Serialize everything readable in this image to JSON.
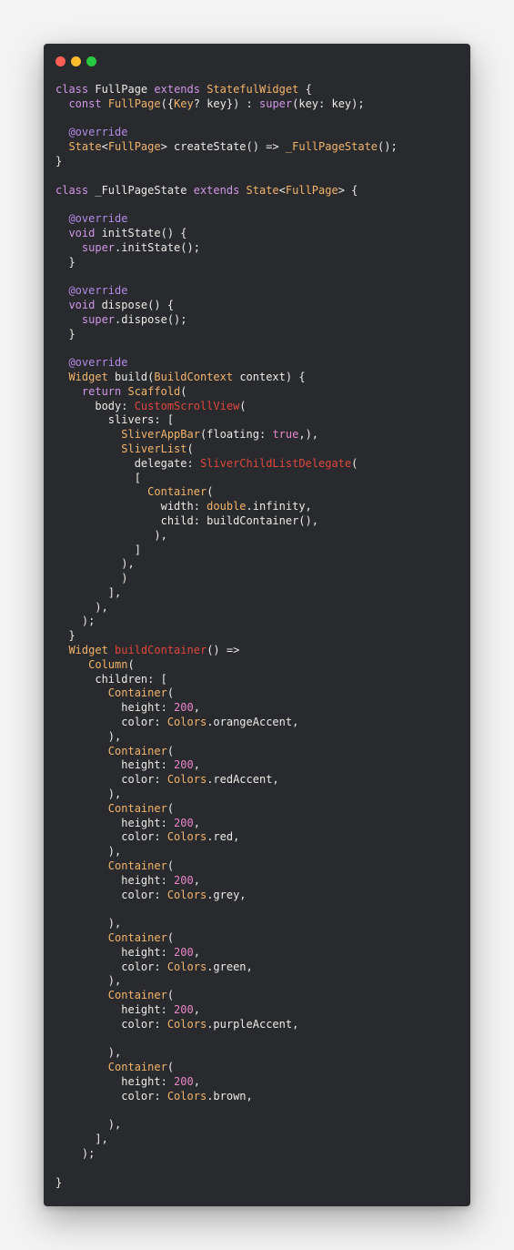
{
  "window": {
    "title_dots": [
      {
        "name": "close-dot",
        "color": "#fe5f57"
      },
      {
        "name": "minimize-dot",
        "color": "#febc2e"
      },
      {
        "name": "zoom-dot",
        "color": "#28c840"
      }
    ]
  },
  "colors": {
    "background": "#282a2e",
    "plain": "#ecebe4",
    "keyword": "#cf97e8",
    "type": "#f3b46b",
    "string": "#e0463e",
    "number": "#eb86c9",
    "decorator": "#b48ae7"
  },
  "code_lines": [
    [
      [
        "kw",
        "class "
      ],
      [
        "plain",
        "FullPage "
      ],
      [
        "kw",
        "extends "
      ],
      [
        "type",
        "StatefulWidget"
      ],
      [
        "plain",
        " {"
      ]
    ],
    [
      [
        "plain",
        "  "
      ],
      [
        "kw",
        "const "
      ],
      [
        "type",
        "FullPage"
      ],
      [
        "plain",
        "({"
      ],
      [
        "type",
        "Key"
      ],
      [
        "plain",
        "? key}) : "
      ],
      [
        "kw",
        "super"
      ],
      [
        "plain",
        "(key: key);"
      ]
    ],
    [],
    [
      [
        "plain",
        "  "
      ],
      [
        "deco",
        "@override"
      ]
    ],
    [
      [
        "plain",
        "  "
      ],
      [
        "type",
        "State"
      ],
      [
        "plain",
        "<"
      ],
      [
        "type",
        "FullPage"
      ],
      [
        "plain",
        "> createState() => "
      ],
      [
        "type",
        "_FullPageState"
      ],
      [
        "plain",
        "();"
      ]
    ],
    [
      [
        "plain",
        "}"
      ]
    ],
    [],
    [
      [
        "kw",
        "class "
      ],
      [
        "plain",
        "_FullPageState "
      ],
      [
        "kw",
        "extends "
      ],
      [
        "type",
        "State"
      ],
      [
        "plain",
        "<"
      ],
      [
        "type",
        "FullPage"
      ],
      [
        "plain",
        "> {"
      ]
    ],
    [],
    [
      [
        "plain",
        "  "
      ],
      [
        "deco",
        "@override"
      ]
    ],
    [
      [
        "plain",
        "  "
      ],
      [
        "kw",
        "void "
      ],
      [
        "plain",
        "initState() {"
      ]
    ],
    [
      [
        "plain",
        "    "
      ],
      [
        "kw",
        "super"
      ],
      [
        "plain",
        ".initState();"
      ]
    ],
    [
      [
        "plain",
        "  }"
      ]
    ],
    [],
    [
      [
        "plain",
        "  "
      ],
      [
        "deco",
        "@override"
      ]
    ],
    [
      [
        "plain",
        "  "
      ],
      [
        "kw",
        "void "
      ],
      [
        "plain",
        "dispose() {"
      ]
    ],
    [
      [
        "plain",
        "    "
      ],
      [
        "kw",
        "super"
      ],
      [
        "plain",
        ".dispose();"
      ]
    ],
    [
      [
        "plain",
        "  }"
      ]
    ],
    [],
    [
      [
        "plain",
        "  "
      ],
      [
        "deco",
        "@override"
      ]
    ],
    [
      [
        "plain",
        "  "
      ],
      [
        "type",
        "Widget "
      ],
      [
        "plain",
        "build("
      ],
      [
        "type",
        "BuildContext "
      ],
      [
        "plain",
        "context) {"
      ]
    ],
    [
      [
        "plain",
        "    "
      ],
      [
        "kw",
        "return "
      ],
      [
        "type",
        "Scaffold"
      ],
      [
        "plain",
        "("
      ]
    ],
    [
      [
        "plain",
        "      body: "
      ],
      [
        "str",
        "CustomScrollView"
      ],
      [
        "plain",
        "("
      ]
    ],
    [
      [
        "plain",
        "        slivers: ["
      ]
    ],
    [
      [
        "plain",
        "          "
      ],
      [
        "type",
        "SliverAppBar"
      ],
      [
        "plain",
        "(floating: "
      ],
      [
        "num",
        "true"
      ],
      [
        "plain",
        ",),"
      ]
    ],
    [
      [
        "plain",
        "          "
      ],
      [
        "type",
        "SliverList"
      ],
      [
        "plain",
        "("
      ]
    ],
    [
      [
        "plain",
        "            delegate: "
      ],
      [
        "str",
        "SliverChildListDelegate"
      ],
      [
        "plain",
        "("
      ]
    ],
    [
      [
        "plain",
        "            ["
      ]
    ],
    [
      [
        "plain",
        "              "
      ],
      [
        "type",
        "Container"
      ],
      [
        "plain",
        "("
      ]
    ],
    [
      [
        "plain",
        "                width: "
      ],
      [
        "type",
        "double"
      ],
      [
        "plain",
        ".infinity,"
      ]
    ],
    [
      [
        "plain",
        "                child: buildContainer(),"
      ]
    ],
    [
      [
        "plain",
        "               ),"
      ]
    ],
    [
      [
        "plain",
        "            ]"
      ]
    ],
    [
      [
        "plain",
        "          ),"
      ]
    ],
    [
      [
        "plain",
        "          )"
      ]
    ],
    [
      [
        "plain",
        "        ],"
      ]
    ],
    [
      [
        "plain",
        "      ),"
      ]
    ],
    [
      [
        "plain",
        "    );"
      ]
    ],
    [
      [
        "plain",
        "  }"
      ]
    ],
    [
      [
        "plain",
        "  "
      ],
      [
        "type",
        "Widget "
      ],
      [
        "str",
        "buildContainer"
      ],
      [
        "plain",
        "() =>"
      ]
    ],
    [
      [
        "plain",
        "     "
      ],
      [
        "type",
        "Column"
      ],
      [
        "plain",
        "("
      ]
    ],
    [
      [
        "plain",
        "      children: ["
      ]
    ],
    [
      [
        "plain",
        "        "
      ],
      [
        "type",
        "Container"
      ],
      [
        "plain",
        "("
      ]
    ],
    [
      [
        "plain",
        "          height: "
      ],
      [
        "num",
        "200"
      ],
      [
        "plain",
        ","
      ]
    ],
    [
      [
        "plain",
        "          color: "
      ],
      [
        "type",
        "Colors"
      ],
      [
        "plain",
        ".orangeAccent,"
      ]
    ],
    [
      [
        "plain",
        "        ),"
      ]
    ],
    [
      [
        "plain",
        "        "
      ],
      [
        "type",
        "Container"
      ],
      [
        "plain",
        "("
      ]
    ],
    [
      [
        "plain",
        "          height: "
      ],
      [
        "num",
        "200"
      ],
      [
        "plain",
        ","
      ]
    ],
    [
      [
        "plain",
        "          color: "
      ],
      [
        "type",
        "Colors"
      ],
      [
        "plain",
        ".redAccent,"
      ]
    ],
    [
      [
        "plain",
        "        ),"
      ]
    ],
    [
      [
        "plain",
        "        "
      ],
      [
        "type",
        "Container"
      ],
      [
        "plain",
        "("
      ]
    ],
    [
      [
        "plain",
        "          height: "
      ],
      [
        "num",
        "200"
      ],
      [
        "plain",
        ","
      ]
    ],
    [
      [
        "plain",
        "          color: "
      ],
      [
        "type",
        "Colors"
      ],
      [
        "plain",
        ".red,"
      ]
    ],
    [
      [
        "plain",
        "        ),"
      ]
    ],
    [
      [
        "plain",
        "        "
      ],
      [
        "type",
        "Container"
      ],
      [
        "plain",
        "("
      ]
    ],
    [
      [
        "plain",
        "          height: "
      ],
      [
        "num",
        "200"
      ],
      [
        "plain",
        ","
      ]
    ],
    [
      [
        "plain",
        "          color: "
      ],
      [
        "type",
        "Colors"
      ],
      [
        "plain",
        ".grey,"
      ]
    ],
    [],
    [
      [
        "plain",
        "        ),"
      ]
    ],
    [
      [
        "plain",
        "        "
      ],
      [
        "type",
        "Container"
      ],
      [
        "plain",
        "("
      ]
    ],
    [
      [
        "plain",
        "          height: "
      ],
      [
        "num",
        "200"
      ],
      [
        "plain",
        ","
      ]
    ],
    [
      [
        "plain",
        "          color: "
      ],
      [
        "type",
        "Colors"
      ],
      [
        "plain",
        ".green,"
      ]
    ],
    [
      [
        "plain",
        "        ),"
      ]
    ],
    [
      [
        "plain",
        "        "
      ],
      [
        "type",
        "Container"
      ],
      [
        "plain",
        "("
      ]
    ],
    [
      [
        "plain",
        "          height: "
      ],
      [
        "num",
        "200"
      ],
      [
        "plain",
        ","
      ]
    ],
    [
      [
        "plain",
        "          color: "
      ],
      [
        "type",
        "Colors"
      ],
      [
        "plain",
        ".purpleAccent,"
      ]
    ],
    [],
    [
      [
        "plain",
        "        ),"
      ]
    ],
    [
      [
        "plain",
        "        "
      ],
      [
        "type",
        "Container"
      ],
      [
        "plain",
        "("
      ]
    ],
    [
      [
        "plain",
        "          height: "
      ],
      [
        "num",
        "200"
      ],
      [
        "plain",
        ","
      ]
    ],
    [
      [
        "plain",
        "          color: "
      ],
      [
        "type",
        "Colors"
      ],
      [
        "plain",
        ".brown,"
      ]
    ],
    [],
    [
      [
        "plain",
        "        ),"
      ]
    ],
    [
      [
        "plain",
        "      ],"
      ]
    ],
    [
      [
        "plain",
        "    );"
      ]
    ],
    [],
    [
      [
        "plain",
        "}"
      ]
    ]
  ]
}
